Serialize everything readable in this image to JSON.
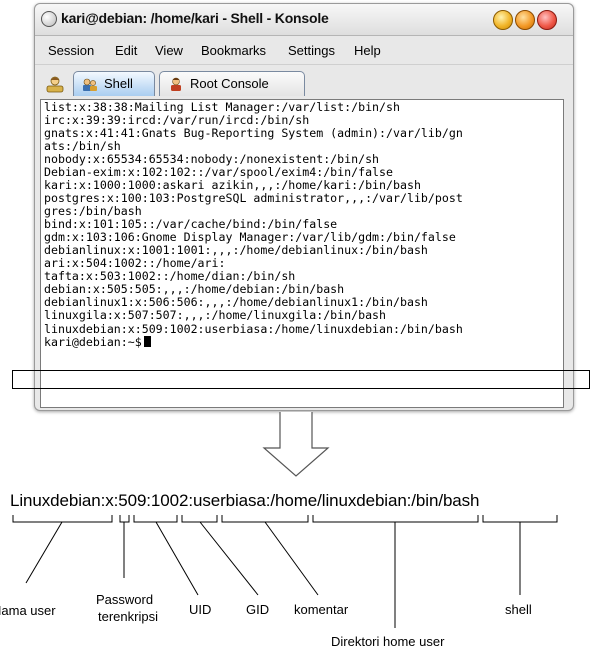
{
  "window": {
    "title": "kari@debian: /home/kari - Shell - Konsole",
    "menu": [
      "Session",
      "Edit",
      "View",
      "Bookmarks",
      "Settings",
      "Help"
    ],
    "tabs": [
      {
        "label": "Shell",
        "icon": "shell-icon",
        "active": true
      },
      {
        "label": "Root Console",
        "icon": "root-console-icon",
        "active": false
      }
    ]
  },
  "terminal": {
    "lines": [
      "list:x:38:38:Mailing List Manager:/var/list:/bin/sh",
      "irc:x:39:39:ircd:/var/run/ircd:/bin/sh",
      "gnats:x:41:41:Gnats Bug-Reporting System (admin):/var/lib/gn",
      "ats:/bin/sh",
      "nobody:x:65534:65534:nobody:/nonexistent:/bin/sh",
      "Debian-exim:x:102:102::/var/spool/exim4:/bin/false",
      "kari:x:1000:1000:askari azikin,,,:/home/kari:/bin/bash",
      "postgres:x:100:103:PostgreSQL administrator,,,:/var/lib/post",
      "gres:/bin/bash",
      "bind:x:101:105::/var/cache/bind:/bin/false",
      "gdm:x:103:106:Gnome Display Manager:/var/lib/gdm:/bin/false",
      "debianlinux:x:1001:1001:,,,:/home/debianlinux:/bin/bash",
      "ari:x:504:1002::/home/ari:",
      "tafta:x:503:1002::/home/dian:/bin/sh",
      "debian:x:505:505:,,,:/home/debian:/bin/bash",
      "debianlinux1:x:506:506:,,,:/home/debianlinux1:/bin/bash",
      "linuxgila:x:507:507:,,,:/home/linuxgila:/bin/bash",
      "linuxdebian:x:509:1002:userbiasa:/home/linuxdebian:/bin/bash"
    ],
    "prompt": "kari@debian:~$"
  },
  "diagram": {
    "entry": "Linuxdebian:x:509:1002:userbiasa:/home/linuxdebian:/bin/bash",
    "labels": {
      "username": "Nama user",
      "password_line1": "Password",
      "password_line2": "terenkripsi",
      "uid": "UID",
      "gid": "GID",
      "comment": "komentar",
      "home": "Direktori home user",
      "shell": "shell"
    }
  }
}
